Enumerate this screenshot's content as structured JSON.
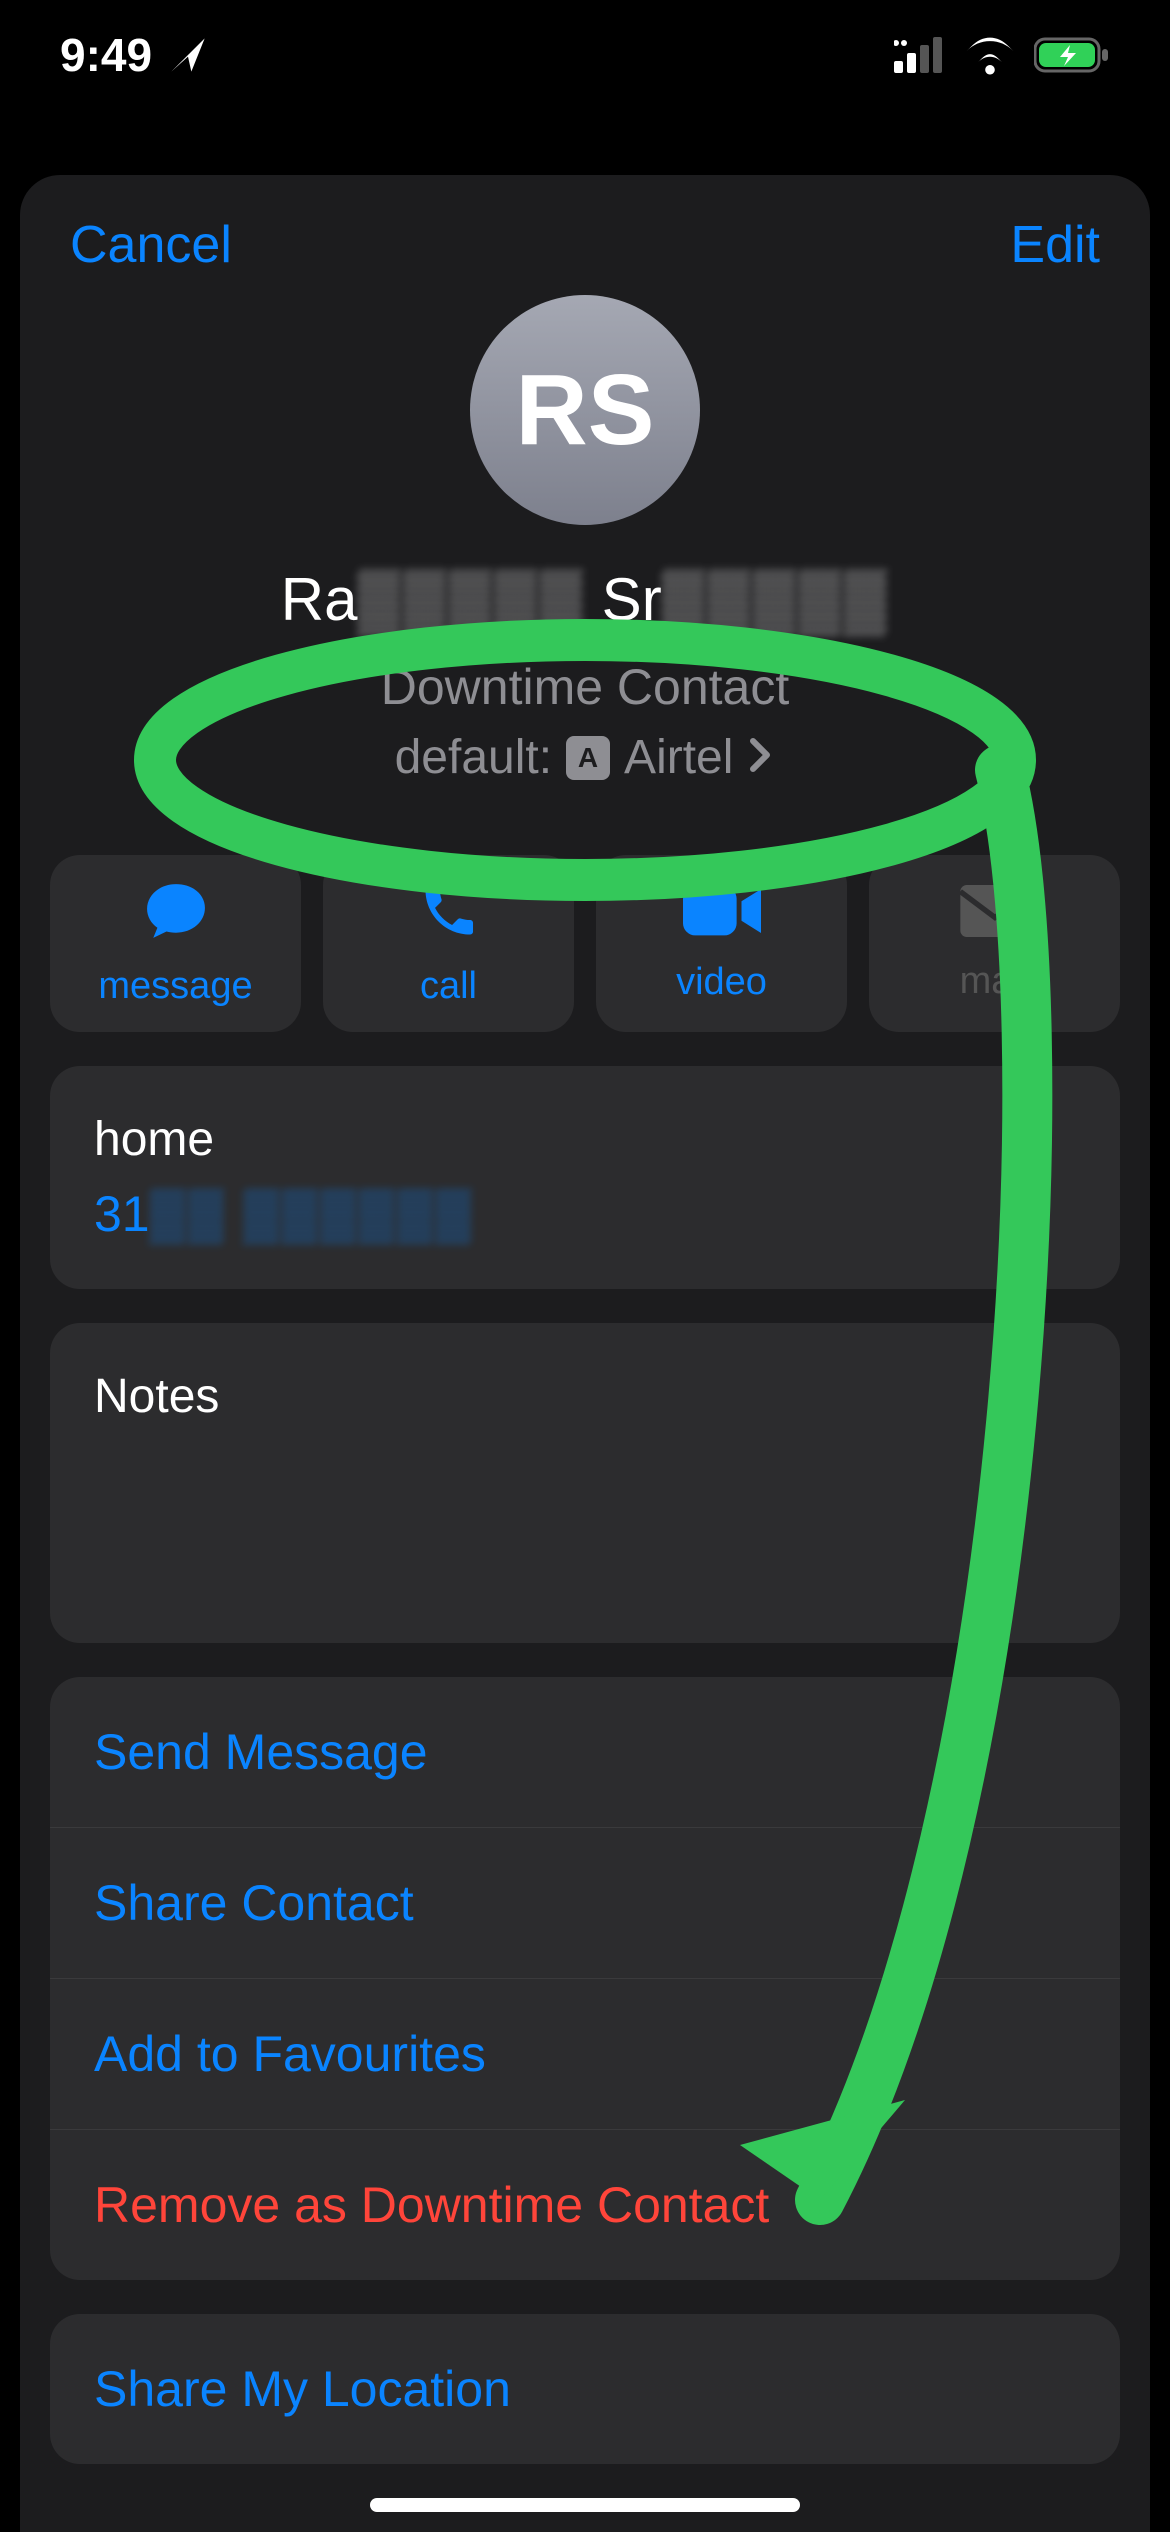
{
  "status": {
    "time": "9:49"
  },
  "nav": {
    "cancel": "Cancel",
    "edit": "Edit"
  },
  "contact": {
    "initials": "RS",
    "name_prefix": "Ra",
    "name_mid_obscured": "▒▒▒▒▒",
    "name_sep": " Sr",
    "name_suffix_obscured": "▒▒▒▒▒",
    "downtime_label": "Downtime Contact",
    "default_prefix": "default:",
    "sim_badge": "A",
    "carrier": "Airtel"
  },
  "tiles": {
    "message": "message",
    "call": "call",
    "video": "video",
    "mail": "mail"
  },
  "phone": {
    "type": "home",
    "number_prefix": "31",
    "number_obscured": "▒▒ ▒▒▒▒▒▒"
  },
  "notes": {
    "label": "Notes"
  },
  "actions": {
    "send_message": "Send Message",
    "share_contact": "Share Contact",
    "add_favourites": "Add to Favourites",
    "remove_downtime": "Remove as Downtime Contact",
    "share_location": "Share My Location"
  }
}
